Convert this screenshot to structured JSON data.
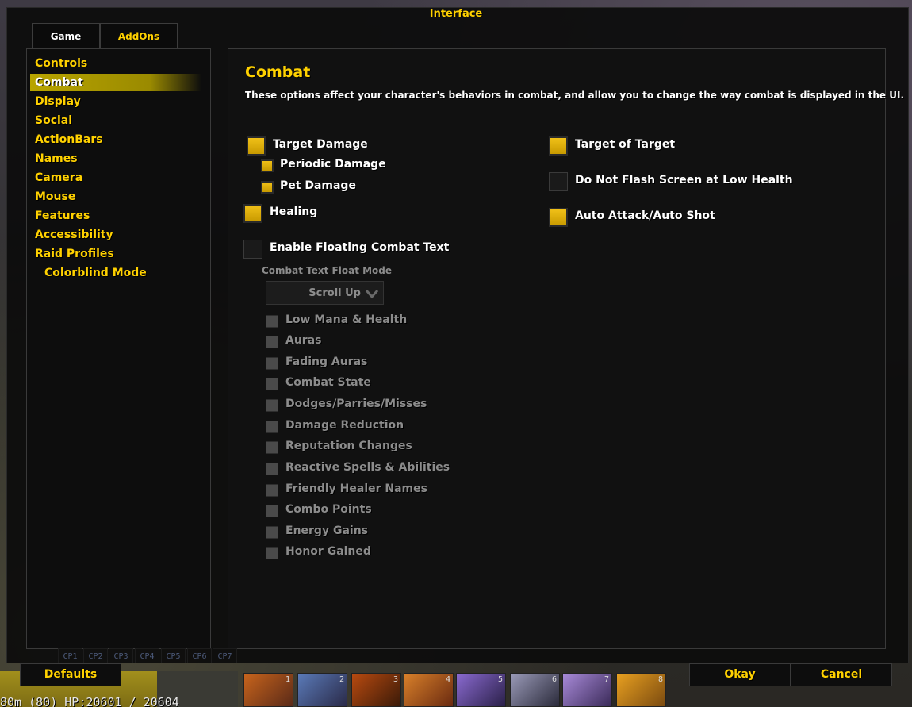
{
  "window": {
    "title": "Interface"
  },
  "tabs": [
    {
      "label": "Game"
    },
    {
      "label": "AddOns"
    }
  ],
  "categories": [
    {
      "label": "Controls"
    },
    {
      "label": "Combat"
    },
    {
      "label": "Display"
    },
    {
      "label": "Social"
    },
    {
      "label": "ActionBars"
    },
    {
      "label": "Names"
    },
    {
      "label": "Camera"
    },
    {
      "label": "Mouse"
    },
    {
      "label": "Features"
    },
    {
      "label": "Accessibility"
    },
    {
      "label": "Raid Profiles"
    },
    {
      "label": "Colorblind Mode"
    }
  ],
  "selected_category": "Combat",
  "panel": {
    "heading": "Combat",
    "description": "These options affect your character's behaviors in combat, and allow you to change the way combat is displayed in the UI."
  },
  "options": {
    "target_damage": {
      "label": "Target Damage",
      "checked": true
    },
    "periodic_damage": {
      "label": "Periodic Damage",
      "checked": true
    },
    "pet_damage": {
      "label": "Pet Damage",
      "checked": true
    },
    "healing": {
      "label": "Healing",
      "checked": true
    },
    "enable_floating_combat_text": {
      "label": "Enable Floating Combat Text",
      "checked": false
    },
    "target_of_target": {
      "label": "Target of Target",
      "checked": true
    },
    "do_not_flash_screen": {
      "label": "Do Not Flash Screen at Low Health",
      "checked": false
    },
    "auto_attack": {
      "label": "Auto Attack/Auto Shot",
      "checked": true
    }
  },
  "float_mode": {
    "label": "Combat Text Float Mode",
    "value": "Scroll Up"
  },
  "disabled_options": [
    {
      "label": "Low Mana & Health"
    },
    {
      "label": "Auras"
    },
    {
      "label": "Fading Auras"
    },
    {
      "label": "Combat State"
    },
    {
      "label": "Dodges/Parries/Misses"
    },
    {
      "label": "Damage Reduction"
    },
    {
      "label": "Reputation Changes"
    },
    {
      "label": "Reactive Spells & Abilities"
    },
    {
      "label": "Friendly Healer Names"
    },
    {
      "label": "Combo Points"
    },
    {
      "label": "Energy Gains"
    },
    {
      "label": "Honor Gained"
    }
  ],
  "buttons": {
    "defaults": "Defaults",
    "okay": "Okay",
    "cancel": "Cancel"
  },
  "background": {
    "combo_point_labels": [
      "CP1",
      "CP2",
      "CP3",
      "CP4",
      "CP5",
      "CP6",
      "CP7"
    ],
    "action_slots": [
      "1",
      "2",
      "3",
      "4",
      "5",
      "6",
      "7",
      "8"
    ],
    "status_line": "80m (80) HP:20601 / 20604"
  },
  "colors": {
    "gold": "#ffd100",
    "checkbox_gold": "#e0b010",
    "selection": "#b8a400"
  }
}
